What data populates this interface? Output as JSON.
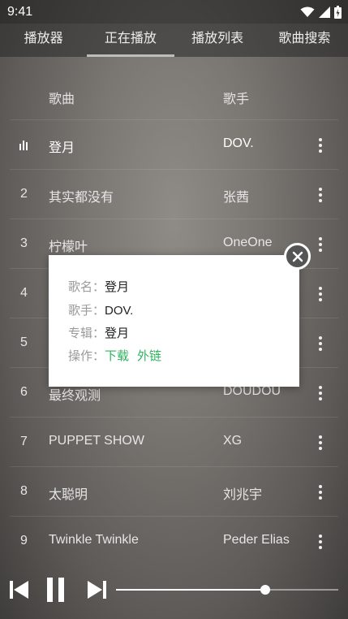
{
  "status": {
    "time": "9:41"
  },
  "tabs": [
    {
      "label": "播放器",
      "active": false
    },
    {
      "label": "正在播放",
      "active": true
    },
    {
      "label": "播放列表",
      "active": false
    },
    {
      "label": "歌曲搜索",
      "active": false
    }
  ],
  "list": {
    "header": {
      "song": "歌曲",
      "artist": "歌手"
    },
    "rows": [
      {
        "index": "",
        "title": "登月",
        "artist": "DOV.",
        "playing": true
      },
      {
        "index": "2",
        "title": "其实都没有",
        "artist": "张茜"
      },
      {
        "index": "3",
        "title": "柠檬叶",
        "artist": "OneOne"
      },
      {
        "index": "4",
        "title": "",
        "artist": ""
      },
      {
        "index": "5",
        "title": "",
        "artist": ""
      },
      {
        "index": "6",
        "title": "最终观测",
        "artist": "DOUDOU"
      },
      {
        "index": "7",
        "title": "PUPPET SHOW",
        "artist": "XG"
      },
      {
        "index": "8",
        "title": "太聪明",
        "artist": "刘兆宇"
      },
      {
        "index": "9",
        "title": "Twinkle Twinkle",
        "artist": "Peder Elias"
      }
    ]
  },
  "popup": {
    "song_label": "歌名：",
    "song_value": "登月",
    "artist_label": "歌手：",
    "artist_value": "DOV.",
    "album_label": "专辑：",
    "album_value": "登月",
    "action_label": "操作：",
    "download": "下载",
    "external_link": "外链"
  },
  "player": {
    "progress": 0.67
  },
  "colors": {
    "accent_green": "#2db55d"
  }
}
